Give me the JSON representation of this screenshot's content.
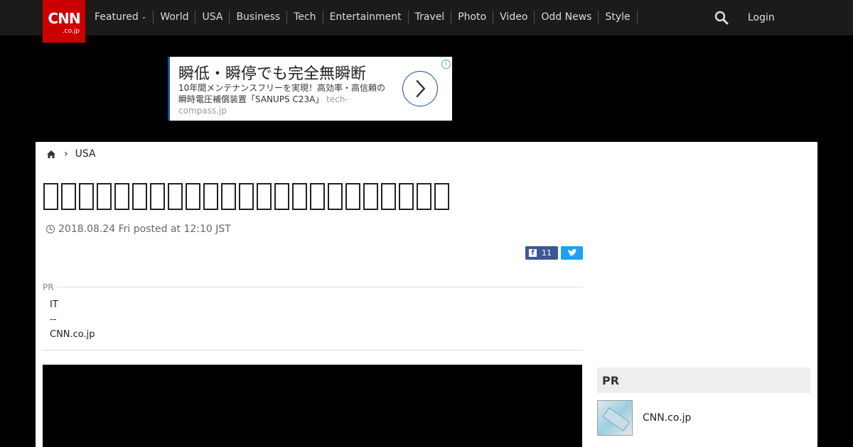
{
  "header": {
    "logo_main": "CNN",
    "logo_sub": ".co.jp",
    "nav": [
      {
        "label": "Featured",
        "has_dropdown": true
      },
      {
        "label": "World"
      },
      {
        "label": "USA"
      },
      {
        "label": "Business"
      },
      {
        "label": "Tech"
      },
      {
        "label": "Entertainment"
      },
      {
        "label": "Travel"
      },
      {
        "label": "Photo"
      },
      {
        "label": "Video"
      },
      {
        "label": "Odd News"
      },
      {
        "label": "Style"
      }
    ],
    "search_icon": "search-icon",
    "login_label": "Login"
  },
  "ad": {
    "headline": "瞬低・瞬停でも完全無瞬断",
    "body": "10年間メンテナンスフリーを実現！高効率・高信頼の瞬時電圧補償装置「SANUPS C23A」",
    "domain": "tech-compass.jp",
    "info_icon": "info-icon",
    "arrow_icon": "chevron-right-icon"
  },
  "breadcrumb": {
    "home_icon": "home-icon",
    "current": "USA"
  },
  "article": {
    "dateline": "2018.08.24 Fri posted at 12:10 JST",
    "facebook_count": "11"
  },
  "pr_block": {
    "label": "PR",
    "items": [
      "IT",
      "--",
      "CNN.co.jp"
    ]
  },
  "sidebar": {
    "pr_heading": "PR",
    "item_text": "CNN.co.jp"
  },
  "colors": {
    "brand_red": "#cc0000",
    "header_bg": "#1b1b1b",
    "facebook": "#3b5998",
    "twitter": "#1da1f2"
  }
}
